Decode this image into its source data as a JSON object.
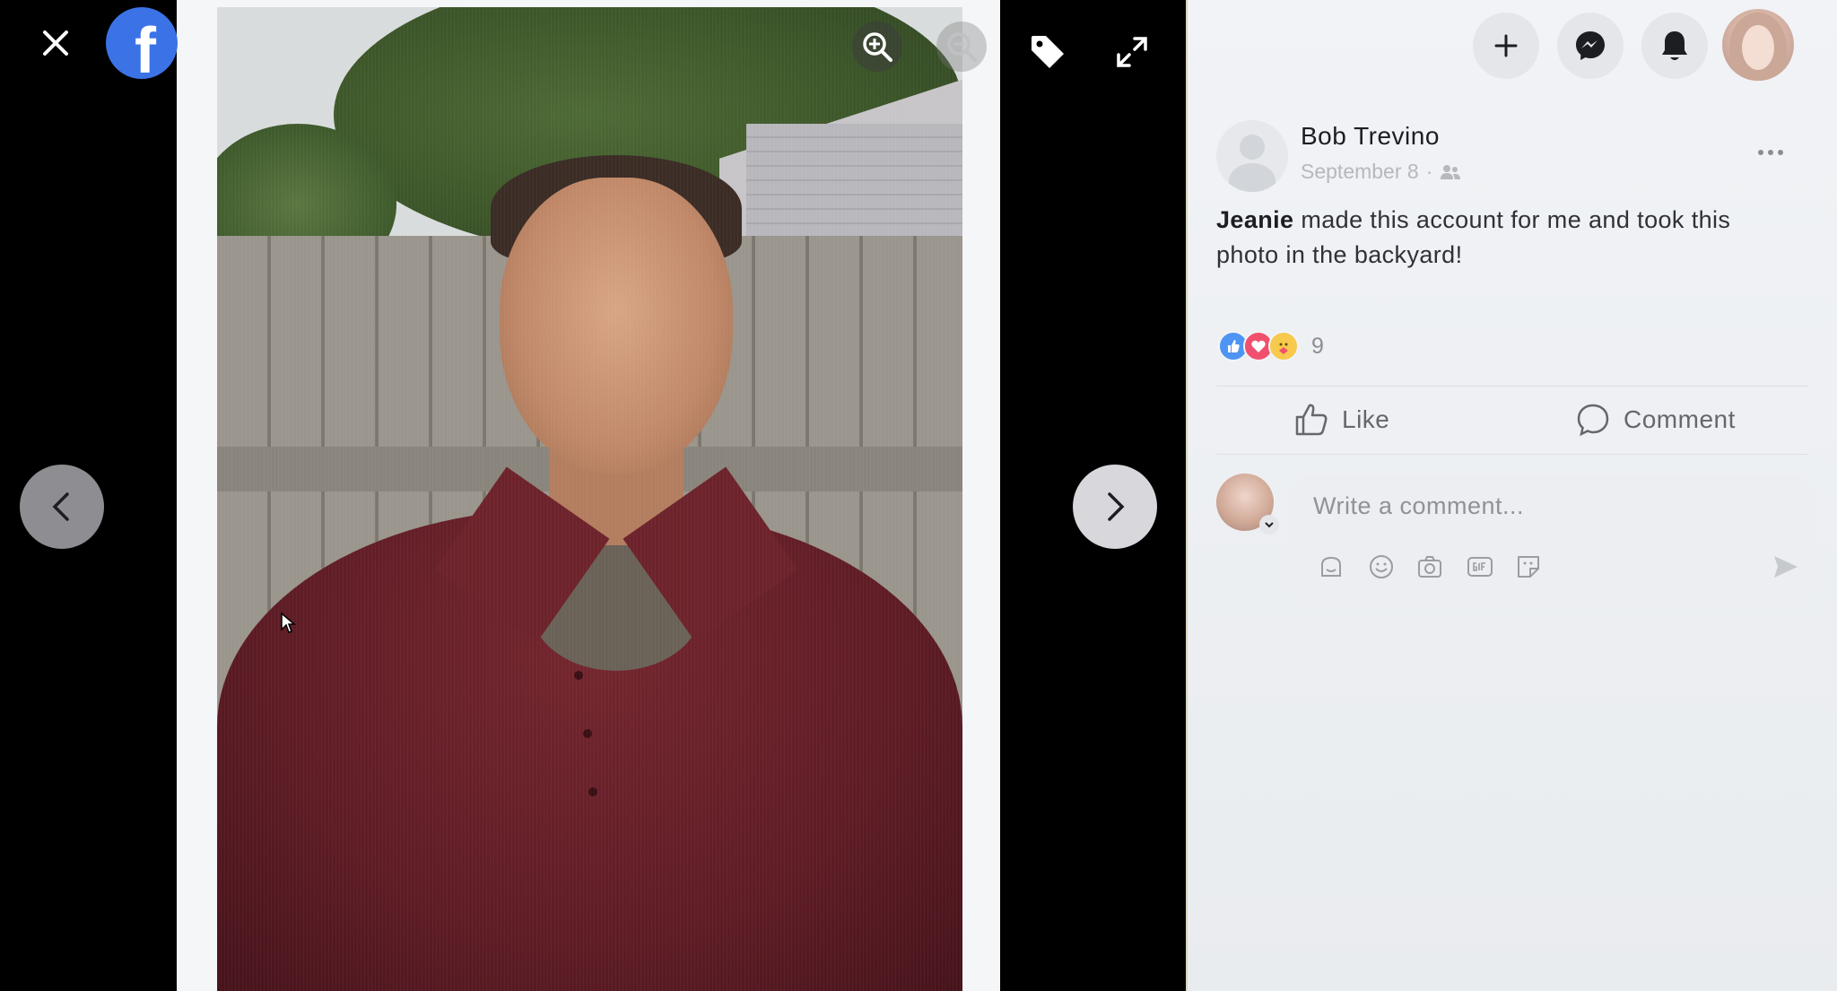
{
  "viewer": {
    "brand_letter": "f",
    "icons": {
      "close": "close-icon",
      "logo": "facebook-logo",
      "zoom_in": "zoom-in-icon",
      "zoom_out": "zoom-out-icon",
      "tag": "tag-icon",
      "expand": "expand-icon",
      "prev": "chevron-left-icon",
      "next": "chevron-right-icon"
    }
  },
  "nav": {
    "icons": [
      "plus-icon",
      "messenger-icon",
      "bell-icon",
      "profile-avatar"
    ]
  },
  "post": {
    "author": "Bob Trevino",
    "date": "September 8",
    "date_separator": "·",
    "audience_icon": "friends-icon",
    "text_bold": "Jeanie",
    "text_rest": " made this account for me and took this photo in the backyard!",
    "reactions": [
      "like",
      "love",
      "care"
    ],
    "reaction_count": "9",
    "like_label": "Like",
    "comment_label": "Comment"
  },
  "comment": {
    "placeholder": "Write a comment...",
    "tools": [
      "avatar-sticker-icon",
      "emoji-icon",
      "camera-icon",
      "gif-icon",
      "sticker-icon"
    ],
    "send_icon": "send-icon"
  },
  "colors": {
    "facebook_blue": "#3b73e6",
    "panel_bg": "#f1f3f6",
    "text_primary": "#1c1e21",
    "text_secondary": "#65676b"
  }
}
